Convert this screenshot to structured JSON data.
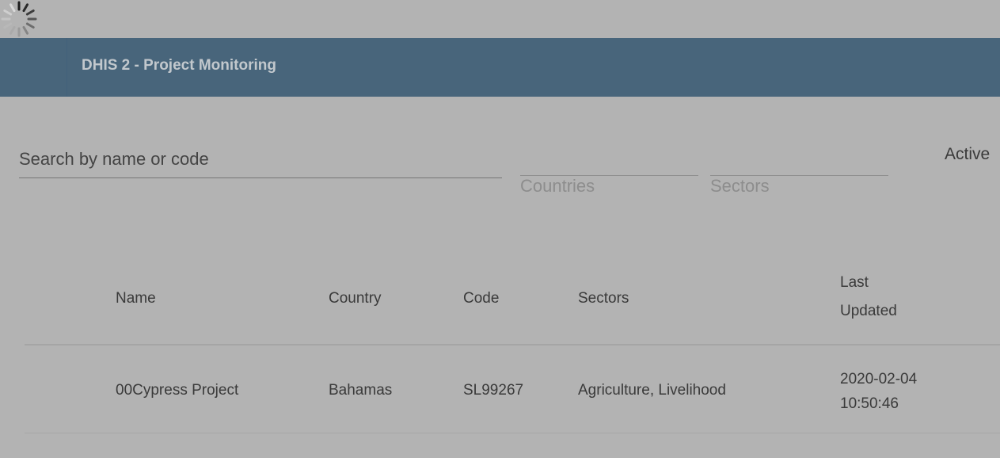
{
  "loading": {
    "icon": "loading-spinner-icon"
  },
  "appbar": {
    "title": "DHIS 2 - Project Monitoring",
    "color": "#48657b"
  },
  "filters": {
    "search_placeholder": "Search by name or code",
    "search_value": "",
    "countries_label": "Countries",
    "sectors_label": "Sectors",
    "active_label": "Active"
  },
  "table": {
    "columns": {
      "name": "Name",
      "country": "Country",
      "code": "Code",
      "sectors": "Sectors",
      "last_updated_line1": "Last",
      "last_updated_line2": "Updated"
    },
    "rows": [
      {
        "name": "00Cypress Project",
        "country": "Bahamas",
        "code": "SL99267",
        "sectors": "Agriculture, Livelihood",
        "last_updated_date": "2020-02-04",
        "last_updated_time": "10:50:46"
      }
    ]
  }
}
